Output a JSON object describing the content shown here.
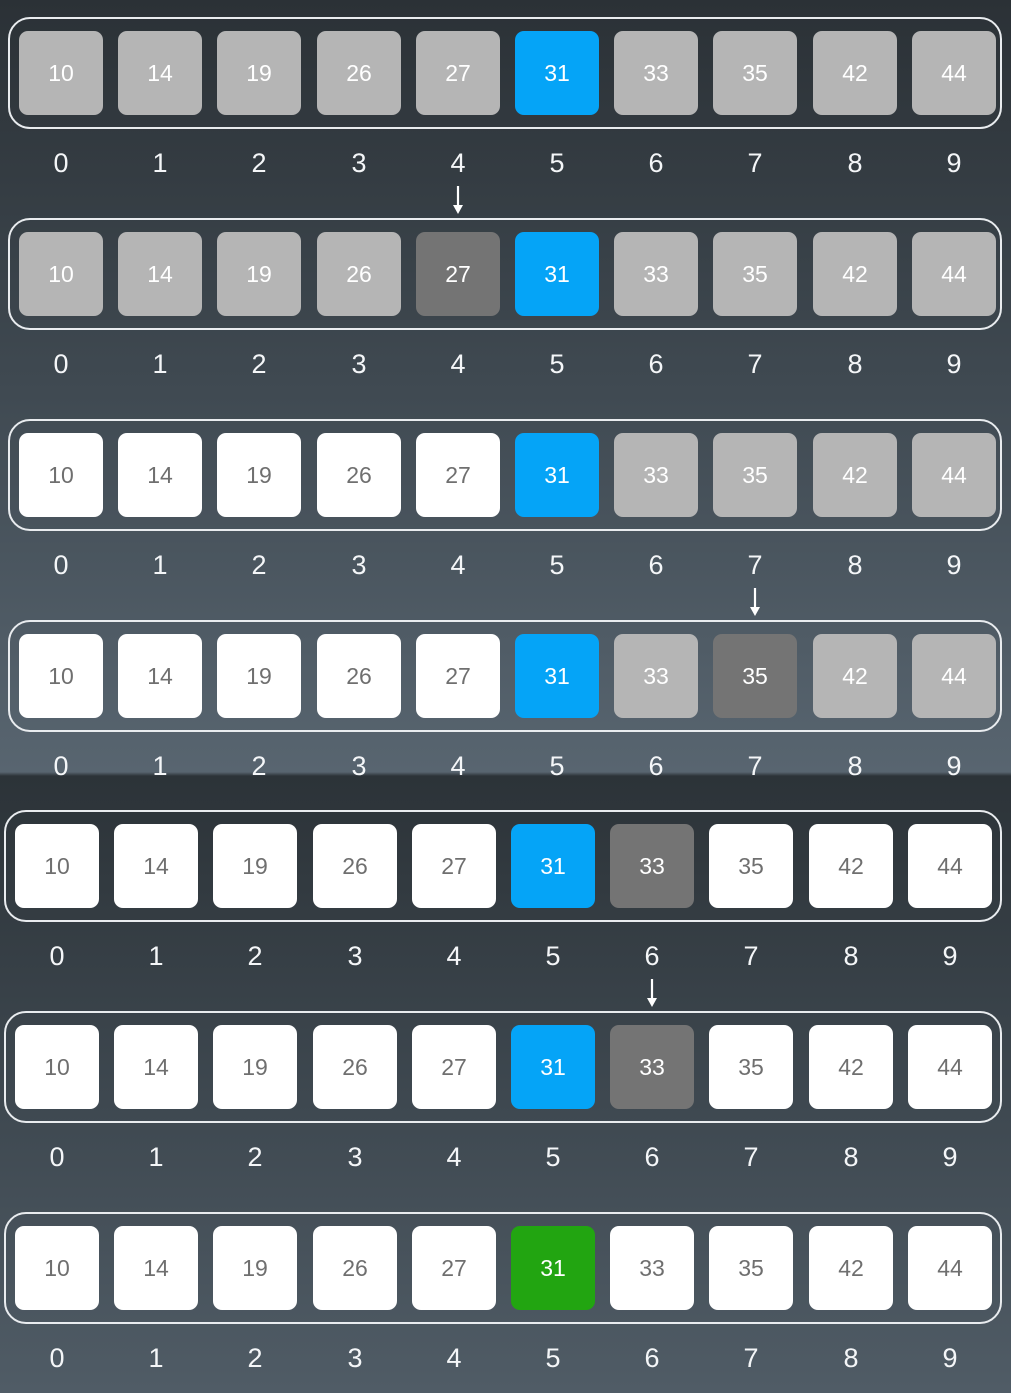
{
  "values": [
    "10",
    "14",
    "19",
    "26",
    "27",
    "31",
    "33",
    "35",
    "42",
    "44"
  ],
  "indices": [
    "0",
    "1",
    "2",
    "3",
    "4",
    "5",
    "6",
    "7",
    "8",
    "9"
  ],
  "rows": [
    {
      "states": [
        "inactive",
        "inactive",
        "inactive",
        "inactive",
        "inactive",
        "target",
        "inactive",
        "inactive",
        "inactive",
        "inactive"
      ],
      "arrow_at": 4
    },
    {
      "states": [
        "inactive",
        "inactive",
        "inactive",
        "inactive",
        "probe",
        "target",
        "inactive",
        "inactive",
        "inactive",
        "inactive"
      ],
      "arrow_at": null
    },
    {
      "states": [
        "plain",
        "plain",
        "plain",
        "plain",
        "plain",
        "target",
        "inactive",
        "inactive",
        "inactive",
        "inactive"
      ],
      "arrow_at": 7
    },
    {
      "states": [
        "plain",
        "plain",
        "plain",
        "plain",
        "plain",
        "target",
        "inactive",
        "probe",
        "inactive",
        "inactive"
      ],
      "arrow_at": null
    },
    {
      "states": [
        "plain",
        "plain",
        "plain",
        "plain",
        "plain",
        "target",
        "probe",
        "plain",
        "plain",
        "plain"
      ],
      "arrow_at": 6
    },
    {
      "states": [
        "plain",
        "plain",
        "plain",
        "plain",
        "plain",
        "target",
        "probe",
        "plain",
        "plain",
        "plain"
      ],
      "arrow_at": null
    },
    {
      "states": [
        "plain",
        "plain",
        "plain",
        "plain",
        "plain",
        "found",
        "plain",
        "plain",
        "plain",
        "plain"
      ],
      "arrow_at": null
    }
  ],
  "colors": {
    "inactive": "#b5b5b5",
    "plain": "#ffffff",
    "probe": "#747474",
    "target": "#05a4f7",
    "found": "#22a511"
  }
}
